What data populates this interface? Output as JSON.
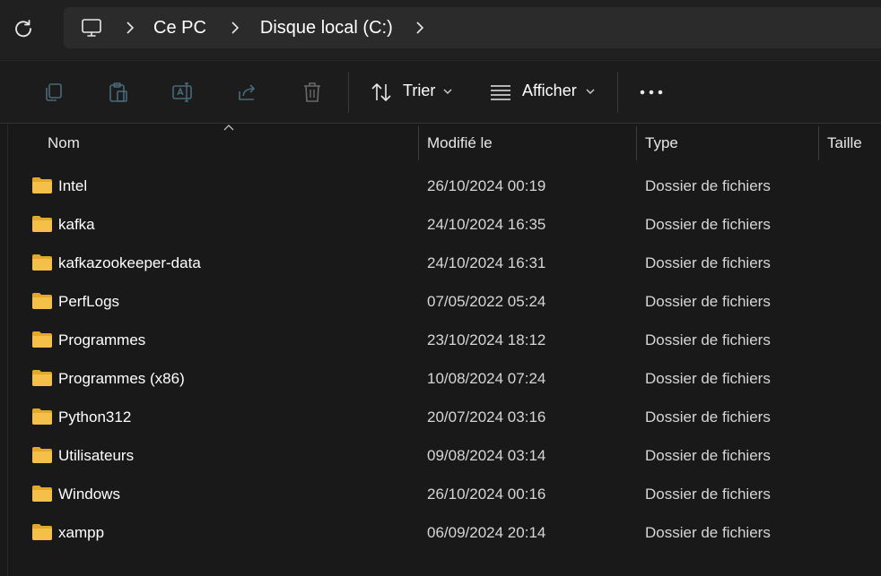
{
  "address_bar": {
    "crumbs": [
      "Ce PC",
      "Disque local (C:)"
    ]
  },
  "toolbar": {
    "sort_label": "Trier",
    "view_label": "Afficher"
  },
  "columns": {
    "name": "Nom",
    "modified": "Modifié le",
    "type": "Type",
    "size": "Taille"
  },
  "rows": [
    {
      "name": "Intel",
      "modified": "26/10/2024 00:19",
      "type": "Dossier de fichiers"
    },
    {
      "name": "kafka",
      "modified": "24/10/2024 16:35",
      "type": "Dossier de fichiers"
    },
    {
      "name": "kafkazookeeper-data",
      "modified": "24/10/2024 16:31",
      "type": "Dossier de fichiers"
    },
    {
      "name": "PerfLogs",
      "modified": "07/05/2022 05:24",
      "type": "Dossier de fichiers"
    },
    {
      "name": "Programmes",
      "modified": "23/10/2024 18:12",
      "type": "Dossier de fichiers"
    },
    {
      "name": "Programmes (x86)",
      "modified": "10/08/2024 07:24",
      "type": "Dossier de fichiers"
    },
    {
      "name": "Python312",
      "modified": "20/07/2024 03:16",
      "type": "Dossier de fichiers"
    },
    {
      "name": "Utilisateurs",
      "modified": "09/08/2024 03:14",
      "type": "Dossier de fichiers"
    },
    {
      "name": "Windows",
      "modified": "26/10/2024 00:16",
      "type": "Dossier de fichiers"
    },
    {
      "name": "xampp",
      "modified": "06/09/2024 20:14",
      "type": "Dossier de fichiers"
    }
  ],
  "icons": {
    "refresh": "refresh-icon",
    "computer": "computer-icon",
    "copy": "copy-icon",
    "paste": "paste-icon",
    "rename": "rename-icon",
    "share": "share-icon",
    "delete": "delete-icon",
    "sort": "sort-icon",
    "view": "view-icon",
    "more": "more-icon",
    "folder": "folder-icon"
  },
  "colors": {
    "background": "#191919",
    "folder": "#f5c04a",
    "disabled_icon": "#4a6a7a"
  }
}
